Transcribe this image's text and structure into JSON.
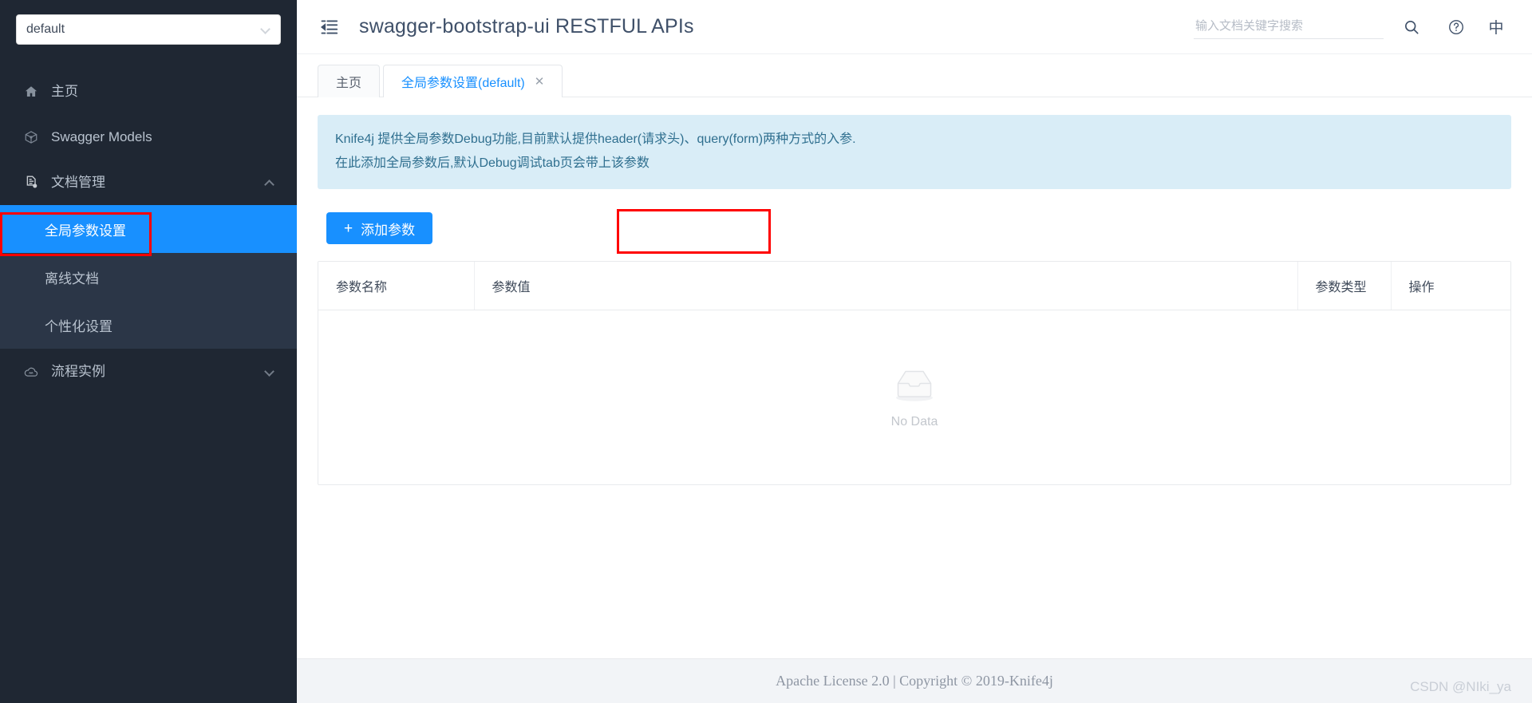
{
  "sidebar": {
    "service_select": {
      "value": "default",
      "icon": "chevron-down-icon"
    },
    "items": [
      {
        "label": "主页",
        "icon": "home-icon",
        "type": "link",
        "active": false
      },
      {
        "label": "Swagger Models",
        "icon": "cube-icon",
        "type": "link",
        "active": false
      },
      {
        "label": "文档管理",
        "icon": "document-settings-icon",
        "type": "group",
        "expanded": true,
        "arrow": "chevron-up-icon"
      },
      {
        "label": "流程实例",
        "icon": "cloud-icon",
        "type": "group",
        "expanded": false,
        "arrow": "chevron-down-icon"
      }
    ],
    "submenu": [
      {
        "label": "全局参数设置",
        "active": true
      },
      {
        "label": "离线文档",
        "active": false
      },
      {
        "label": "个性化设置",
        "active": false
      }
    ]
  },
  "topbar": {
    "fold_icon": "menu-fold-icon",
    "title": "swagger-bootstrap-ui RESTFUL APIs",
    "search": {
      "placeholder": "输入文档关键字搜索",
      "value": ""
    },
    "search_icon": "search-icon",
    "help_icon": "question-circle-icon",
    "lang_label": "中"
  },
  "tabs": [
    {
      "label": "主页",
      "active": false,
      "closable": false
    },
    {
      "label": "全局参数设置(default)",
      "active": true,
      "closable": true,
      "close_icon": "close-icon"
    }
  ],
  "alert": {
    "line1": "Knife4j 提供全局参数Debug功能,目前默认提供header(请求头)、query(form)两种方式的入参.",
    "line2": "在此添加全局参数后,默认Debug调试tab页会带上该参数",
    "bg_color": "#d9edf7",
    "text_color": "#2f6f8f"
  },
  "toolbar": {
    "add_param_label": "添加参数",
    "add_param_plus": "+",
    "accent_color": "#1890ff"
  },
  "table": {
    "columns": [
      "参数名称",
      "参数值",
      "参数类型",
      "操作"
    ],
    "rows": [],
    "empty": {
      "text": "No Data",
      "icon": "empty-inbox-icon"
    }
  },
  "footer": {
    "text": "Apache License 2.0 | Copyright © 2019-Knife4j"
  },
  "watermark": {
    "text": "CSDN @NIki_ya"
  },
  "annotations": {
    "color": "#ff0000",
    "boxes": [
      "sidebar-global-params-highlight",
      "add-param-button-highlight"
    ]
  }
}
